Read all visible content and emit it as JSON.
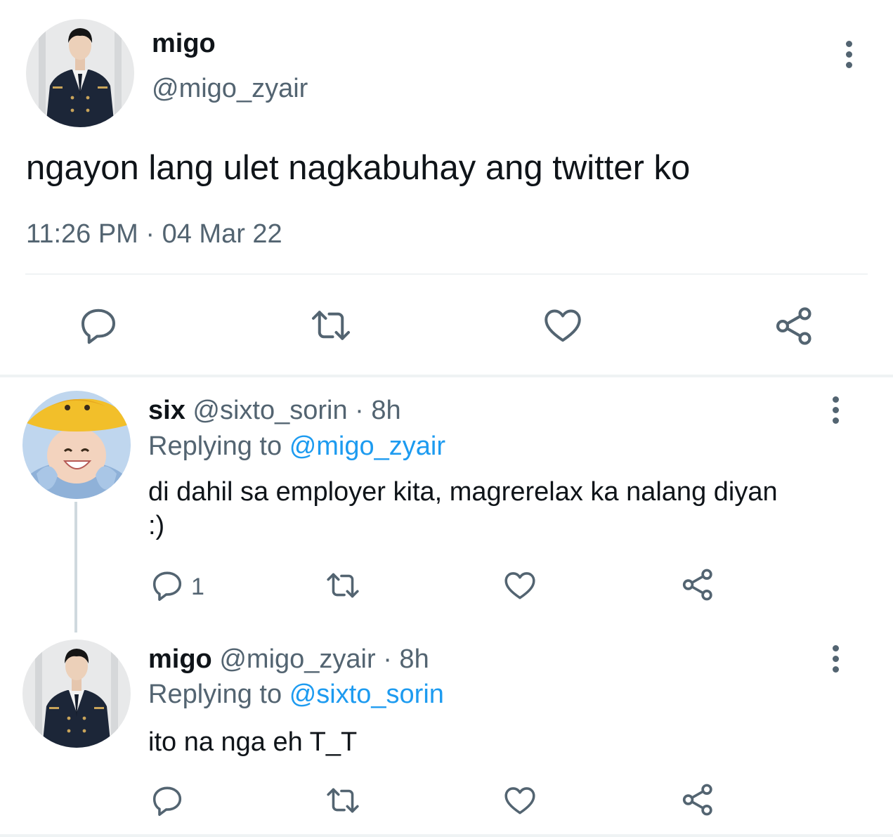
{
  "main_tweet": {
    "display_name": "migo",
    "handle": "@migo_zyair",
    "text": "ngayon lang ulet nagkabuhay ang twitter ko",
    "timestamp": "11:26 PM · 04 Mar 22",
    "actions": [
      "reply-icon",
      "retweet-icon",
      "like-icon",
      "share-icon"
    ]
  },
  "replies": [
    {
      "display_name": "six",
      "handle": "@sixto_sorin",
      "time": "· 8h",
      "replying_prefix": "Replying to",
      "replying_to": "@migo_zyair",
      "text": "di dahil sa employer kita, magrerelax ka nalang diyan :)",
      "reply_count": "1"
    },
    {
      "display_name": "migo",
      "handle": "@migo_zyair",
      "time": "· 8h",
      "replying_prefix": "Replying to",
      "replying_to": "@sixto_sorin",
      "text": "ito na nga eh T_T",
      "reply_count": ""
    }
  ],
  "colors": {
    "text": "#0f1419",
    "secondary": "#536471",
    "link": "#1d9bf0",
    "divider": "#eff3f4"
  }
}
